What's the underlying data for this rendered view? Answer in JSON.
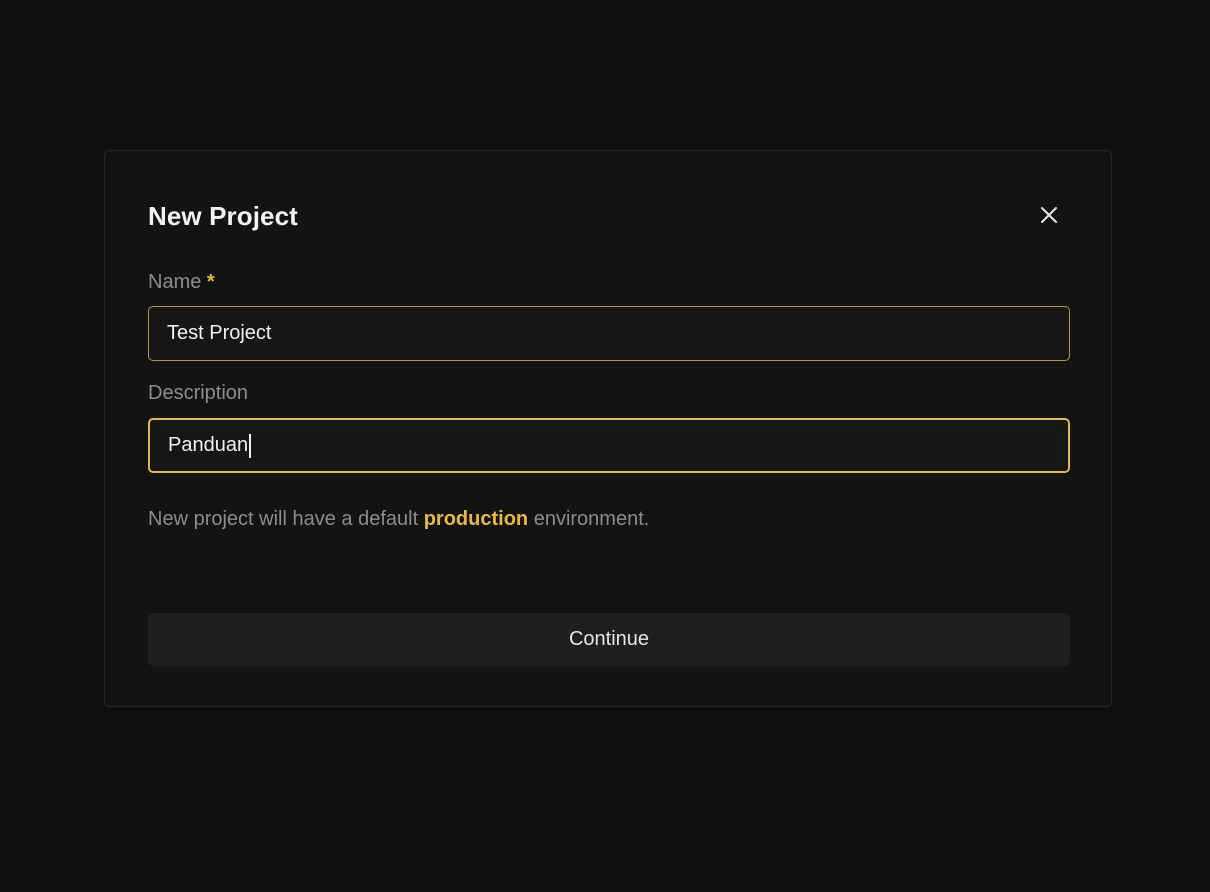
{
  "dialog": {
    "title": "New Project",
    "close_icon": "close-icon",
    "name_field": {
      "label": "Name",
      "required_mark": "*",
      "value": "Test Project"
    },
    "description_field": {
      "label": "Description",
      "value": "Panduan"
    },
    "hint": {
      "prefix": "New project will have a default ",
      "emphasis": "production",
      "suffix": " environment."
    },
    "continue_label": "Continue"
  },
  "colors": {
    "background": "#0f0f0f",
    "dialog_background": "#131313",
    "accent": "#e8b93f",
    "muted_text": "#8c8c8c",
    "button_background": "#1f1f1f"
  }
}
